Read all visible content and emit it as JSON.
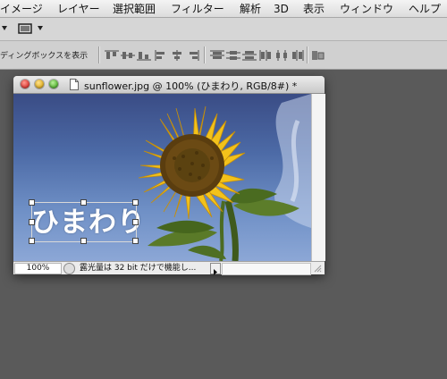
{
  "menubar": {
    "items": [
      "イメージ",
      "レイヤー",
      "選択範囲",
      "フィルター",
      "解析",
      "3D",
      "表示",
      "ウィンドウ",
      "ヘルプ"
    ]
  },
  "options_bar": {
    "bounding_box_label": "ディングボックスを表示"
  },
  "document": {
    "title": "sunflower.jpg @ 100% (ひまわり, RGB/8#) *",
    "canvas_text": "ひまわり",
    "zoom": "100%",
    "status": "露光量は 32 bit だけで機能し..."
  },
  "colors": {
    "workspace": "#5a5a5a",
    "close_light": "#e0443e",
    "minimize_light": "#e4b52f",
    "zoom_light": "#5fb93c",
    "sky_top": "#3a4c85",
    "sky_bottom": "#8ca7d6",
    "petal": "#f3c21b"
  },
  "icons": {
    "screen_mode": "screen-mode-icon",
    "align": [
      "align-top-icon",
      "align-vcenter-icon",
      "align-bottom-icon",
      "align-left-icon",
      "align-hcenter-icon",
      "align-right-icon",
      "distribute-top-icon",
      "distribute-vcenter-icon",
      "distribute-bottom-icon",
      "distribute-left-icon",
      "distribute-hcenter-icon",
      "distribute-right-icon",
      "auto-align-icon"
    ]
  }
}
